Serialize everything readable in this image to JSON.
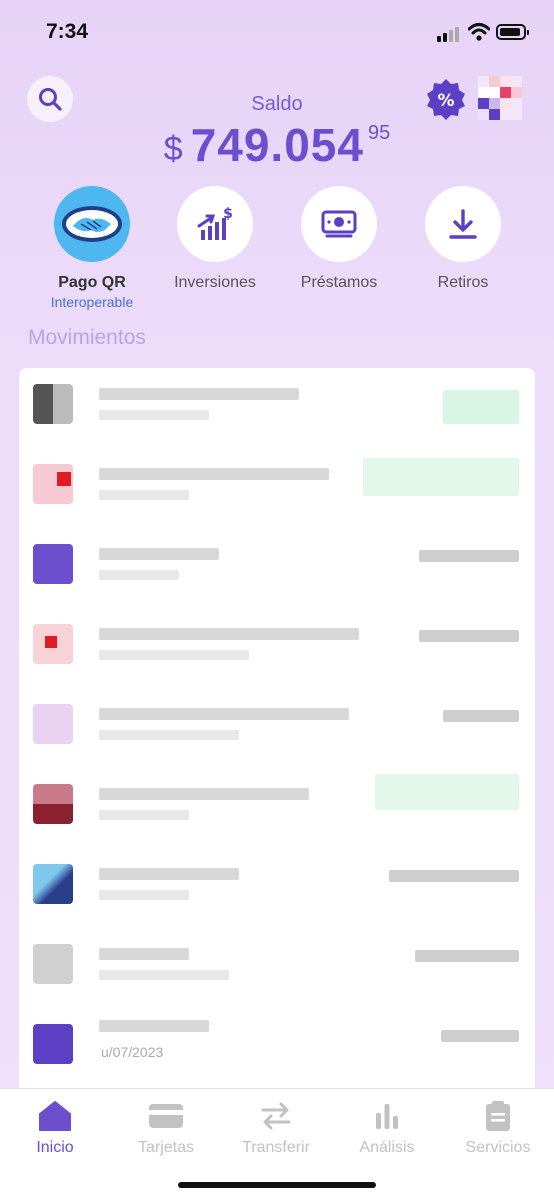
{
  "status_bar": {
    "time": "7:34"
  },
  "header": {
    "balance_label": "Saldo",
    "currency": "$",
    "amount": "749.054",
    "cents": "95"
  },
  "actions": [
    {
      "label": "Pago QR",
      "sublabel": "Interoperable",
      "icon": "handshake-icon"
    },
    {
      "label": "Inversiones",
      "icon": "investment-chart-icon"
    },
    {
      "label": "Préstamos",
      "icon": "money-bill-icon"
    },
    {
      "label": "Retiros",
      "icon": "download-arrow-icon"
    }
  ],
  "movements": {
    "title": "Movimientos",
    "visible_date_fragment": "u/07/2023"
  },
  "tabbar": [
    {
      "label": "Inicio",
      "icon": "home-icon",
      "active": true
    },
    {
      "label": "Tarjetas",
      "icon": "card-icon"
    },
    {
      "label": "Transferir",
      "icon": "transfer-arrows-icon"
    },
    {
      "label": "Análisis",
      "icon": "bar-chart-icon"
    },
    {
      "label": "Servicios",
      "icon": "clipboard-icon"
    }
  ],
  "colors": {
    "accent": "#6b4fcf",
    "qr_blue": "#4fb7f0",
    "background": "#e9d7f8",
    "income_green": "#2ecc71"
  }
}
